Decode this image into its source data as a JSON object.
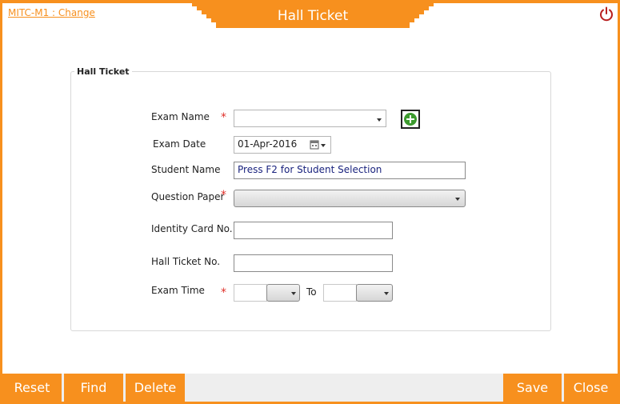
{
  "header": {
    "company_link": "MITC-M1 : Change",
    "title": "Hall Ticket"
  },
  "form": {
    "group_title": "Hall Ticket",
    "exam_name": {
      "label": "Exam Name",
      "value": ""
    },
    "exam_date": {
      "label": "Exam Date",
      "value": "01-Apr-2016"
    },
    "student_name": {
      "label": "Student Name",
      "value": "Press F2 for Student Selection"
    },
    "question_paper": {
      "label": "Question Paper",
      "value": ""
    },
    "identity_card": {
      "label": "Identity Card No.",
      "value": ""
    },
    "hall_ticket_no": {
      "label": "Hall Ticket No.",
      "value": ""
    },
    "exam_time": {
      "label": "Exam Time",
      "to_label": "To",
      "from_value": "",
      "to_value": ""
    },
    "required_marker": "*"
  },
  "footer": {
    "reset": "Reset",
    "find": "Find",
    "delete": "Delete",
    "save": "Save",
    "close": "Close"
  },
  "colors": {
    "accent": "#f7901e",
    "required": "#e0302a",
    "add_icon": "#3c9a2e",
    "power_icon": "#b82020"
  }
}
